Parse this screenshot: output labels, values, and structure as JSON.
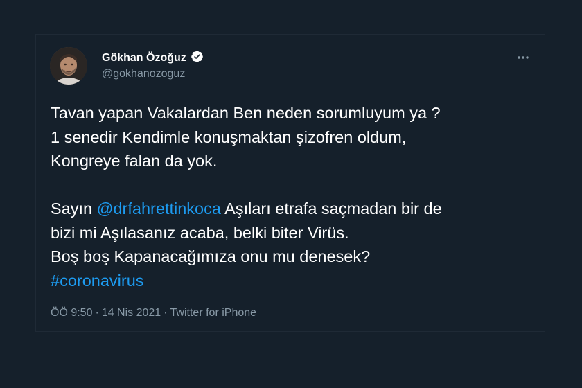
{
  "tweet": {
    "author": {
      "display_name": "Gökhan Özoğuz",
      "handle": "@gokhanozoguz",
      "verified": true,
      "avatar_icon": "avatar-photo"
    },
    "more_icon": "more-horizontal-icon",
    "body": {
      "line1": "Tavan yapan Vakalardan Ben neden sorumluyum ya ?",
      "line2": "1 senedir Kendimle konuşmaktan şizofren oldum,",
      "line3": "Kongreye falan da yok.",
      "line4_prefix": "Sayın ",
      "mention": "@drfahrettinkoca",
      "line4_suffix": " Aşıları etrafa saçmadan bir de",
      "line5": "bizi mi Aşılasanız acaba, belki biter Virüs.",
      "line6": "Boş boş Kapanacağımıza onu mu denesek?",
      "hashtag": "#coronavirus"
    },
    "meta": {
      "time": "ÖÖ 9:50",
      "separator": "·",
      "date": "14 Nis 2021",
      "source": "Twitter for iPhone"
    }
  },
  "colors": {
    "background": "#15202b",
    "text": "#ffffff",
    "secondary": "#8899a6",
    "link": "#1d9bf0"
  }
}
